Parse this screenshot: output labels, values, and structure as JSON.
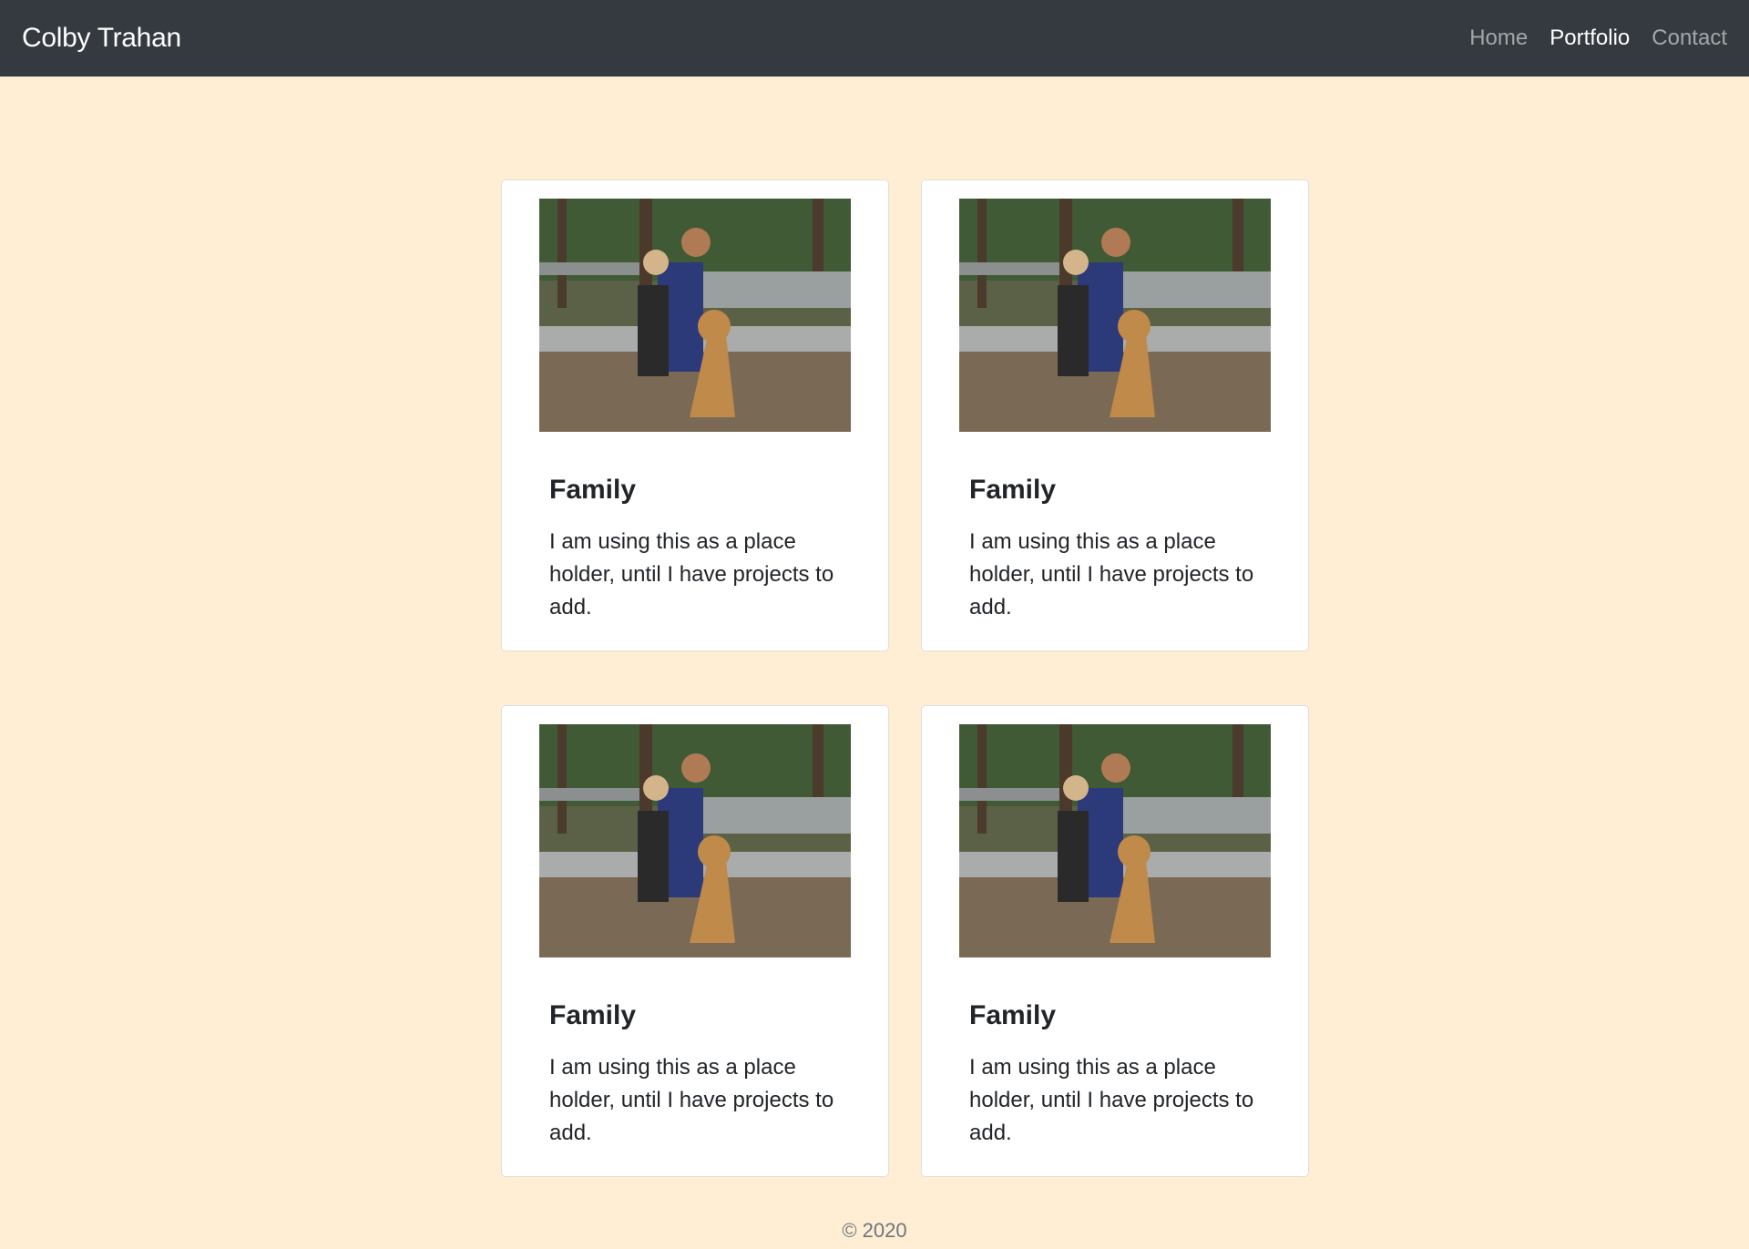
{
  "navbar": {
    "brand": "Colby Trahan",
    "links": [
      {
        "label": "Home",
        "active": false
      },
      {
        "label": "Portfolio",
        "active": true
      },
      {
        "label": "Contact",
        "active": false
      }
    ]
  },
  "cards": [
    {
      "title": "Family",
      "text": "I am using this as a place holder, until I have projects to add."
    },
    {
      "title": "Family",
      "text": "I am using this as a place holder, until I have projects to add."
    },
    {
      "title": "Family",
      "text": "I am using this as a place holder, until I have projects to add."
    },
    {
      "title": "Family",
      "text": "I am using this as a place holder, until I have projects to add."
    }
  ],
  "footer": {
    "text": "© 2020"
  },
  "colors": {
    "navbar": "#343a40",
    "background": "#ffeed3",
    "card": "#ffffff"
  }
}
